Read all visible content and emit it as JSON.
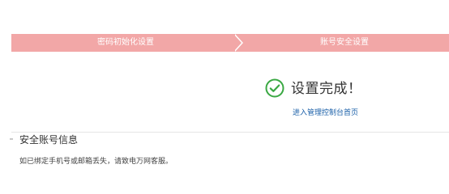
{
  "steps": [
    {
      "label": "密码初始化设置"
    },
    {
      "label": "账号安全设置"
    }
  ],
  "result": {
    "icon": "check-circle-icon",
    "icon_color": "#3aa843",
    "title": "设置完成！",
    "link_label": "进入管理控制台首页"
  },
  "account_info": {
    "section_title": "安全账号信息",
    "notice": "如已绑定手机号或邮箱丢失，请致电万网客服。"
  },
  "colors": {
    "step_bar": "#f2a7a7",
    "link": "#1a5fa8"
  }
}
